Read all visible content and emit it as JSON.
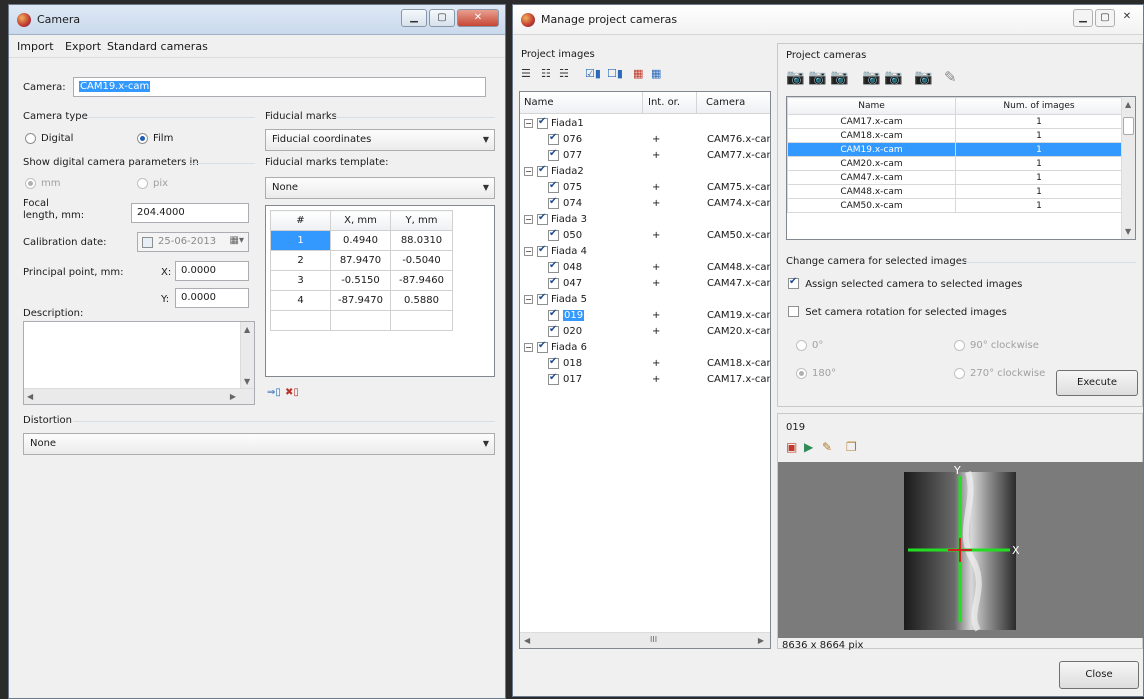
{
  "colors": {
    "selection": "#3399ff",
    "title_bar": "#d3e0ef",
    "preview_bg": "#7b7b7b",
    "axis_green": "#22dd22"
  },
  "camera_window": {
    "title": "Camera",
    "menu": [
      "Import",
      "Export",
      "Standard cameras"
    ],
    "camera_label": "Camera:",
    "camera_value": "CAM19.x-cam",
    "camera_type": {
      "label": "Camera type",
      "options": [
        "Digital",
        "Film"
      ],
      "selected": "Film"
    },
    "show_params": {
      "label": "Show digital camera parameters in",
      "options": [
        "mm",
        "pix"
      ],
      "selected": "mm"
    },
    "focal": {
      "label_line1": "Focal",
      "label_line2": "length, mm:",
      "value": "204.4000"
    },
    "calibration": {
      "label": "Calibration date:",
      "value": "25-06-2013"
    },
    "principal": {
      "label": "Principal point, mm:",
      "x_label": "X:",
      "x_value": "0.0000",
      "y_label": "Y:",
      "y_value": "0.0000"
    },
    "description_label": "Description:",
    "fiducial_marks": {
      "label": "Fiducial marks",
      "value": "Fiducial coordinates"
    },
    "fiducial_template": {
      "label": "Fiducial marks template:",
      "value": "None"
    },
    "fiducial_table": {
      "headers": [
        "#",
        "X, mm",
        "Y, mm"
      ],
      "rows": [
        [
          "1",
          "0.4940",
          "88.0310"
        ],
        [
          "2",
          "87.9470",
          "-0.5040"
        ],
        [
          "3",
          "-0.5150",
          "-87.9460"
        ],
        [
          "4",
          "-87.9470",
          "0.5880"
        ]
      ]
    },
    "distortion": {
      "label": "Distortion",
      "value": "None"
    }
  },
  "manage_window": {
    "title": "Manage project cameras",
    "project_images_label": "Project images",
    "tree_headers": [
      "Name",
      "Int. or.",
      "Camera"
    ],
    "tree": [
      {
        "group": "Fiada1",
        "items": [
          {
            "name": "076",
            "intor": "+",
            "camera": "CAM76.x-cam"
          },
          {
            "name": "077",
            "intor": "+",
            "camera": "CAM77.x-cam"
          }
        ]
      },
      {
        "group": "Fiada2",
        "items": [
          {
            "name": "075",
            "intor": "+",
            "camera": "CAM75.x-cam"
          },
          {
            "name": "074",
            "intor": "+",
            "camera": "CAM74.x-cam"
          }
        ]
      },
      {
        "group": "Fiada 3",
        "items": [
          {
            "name": "050",
            "intor": "+",
            "camera": "CAM50.x-cam"
          }
        ]
      },
      {
        "group": "Fiada 4",
        "items": [
          {
            "name": "048",
            "intor": "+",
            "camera": "CAM48.x-cam"
          },
          {
            "name": "047",
            "intor": "+",
            "camera": "CAM47.x-cam"
          }
        ]
      },
      {
        "group": "Fiada 5",
        "items": [
          {
            "name": "019",
            "intor": "+",
            "camera": "CAM19.x-cam",
            "selected": true
          },
          {
            "name": "020",
            "intor": "+",
            "camera": "CAM20.x-cam"
          }
        ]
      },
      {
        "group": "Fiada 6",
        "items": [
          {
            "name": "018",
            "intor": "+",
            "camera": "CAM18.x-cam"
          },
          {
            "name": "017",
            "intor": "+",
            "camera": "CAM17.x-cam"
          }
        ]
      }
    ],
    "tree_scroll_mark": "III",
    "project_cameras_label": "Project cameras",
    "cameras_headers": [
      "Name",
      "Num. of images"
    ],
    "cameras": [
      {
        "name": "CAM17.x-cam",
        "count": "1"
      },
      {
        "name": "CAM18.x-cam",
        "count": "1"
      },
      {
        "name": "CAM19.x-cam",
        "count": "1",
        "selected": true
      },
      {
        "name": "CAM20.x-cam",
        "count": "1"
      },
      {
        "name": "CAM47.x-cam",
        "count": "1"
      },
      {
        "name": "CAM48.x-cam",
        "count": "1"
      },
      {
        "name": "CAM50.x-cam",
        "count": "1"
      }
    ],
    "change_label": "Change camera for selected images",
    "assign_label": "Assign selected camera to selected images",
    "rotation_label": "Set camera rotation for selected images",
    "rotations": [
      "0°",
      "90° clockwise",
      "180°",
      "270° clockwise"
    ],
    "rotation_selected": "180°",
    "execute_label": "Execute",
    "preview_title": "019",
    "preview_size": "8636 x 8664 pix",
    "close_label": "Close"
  }
}
